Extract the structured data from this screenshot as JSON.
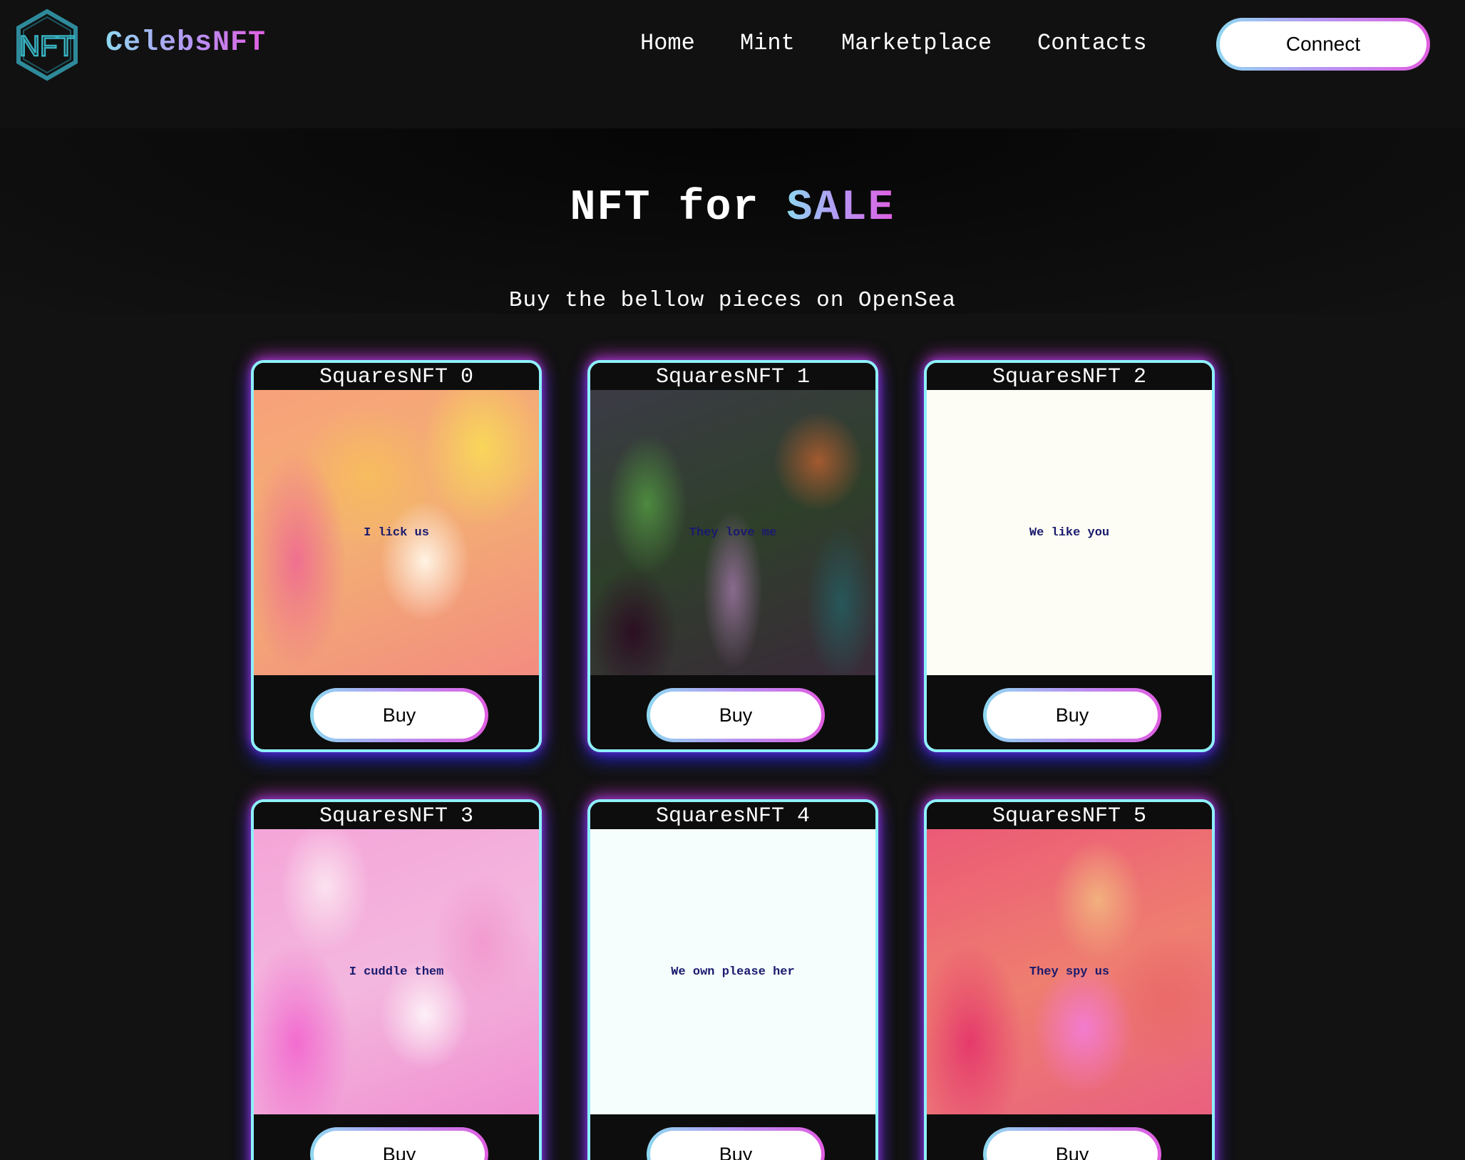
{
  "header": {
    "brand": "CelebsNFT",
    "logo_text": "NFT",
    "nav": [
      {
        "label": "Home"
      },
      {
        "label": "Mint"
      },
      {
        "label": "Marketplace"
      },
      {
        "label": "Contacts"
      }
    ],
    "connect_label": "Connect"
  },
  "hero": {
    "title_prefix": "NFT for",
    "title_accent": "SALE",
    "subtitle": "Buy the bellow pieces on OpenSea"
  },
  "cards": [
    {
      "title": "SquaresNFT 0",
      "caption": "I lick us",
      "buy_label": "Buy"
    },
    {
      "title": "SquaresNFT 1",
      "caption": "They love me",
      "buy_label": "Buy"
    },
    {
      "title": "SquaresNFT 2",
      "caption": "We like you",
      "buy_label": "Buy"
    },
    {
      "title": "SquaresNFT 3",
      "caption": "I cuddle them",
      "buy_label": "Buy"
    },
    {
      "title": "SquaresNFT 4",
      "caption": "We own please her",
      "buy_label": "Buy"
    },
    {
      "title": "SquaresNFT 5",
      "caption": "They spy us",
      "buy_label": "Buy"
    }
  ],
  "colors": {
    "background": "#121212",
    "card_border": "#8ef0fb",
    "gradient_start": "#8fd8f0",
    "gradient_mid": "#b794f4",
    "gradient_end": "#e05ee0",
    "caption_text": "#1a1a6e"
  }
}
